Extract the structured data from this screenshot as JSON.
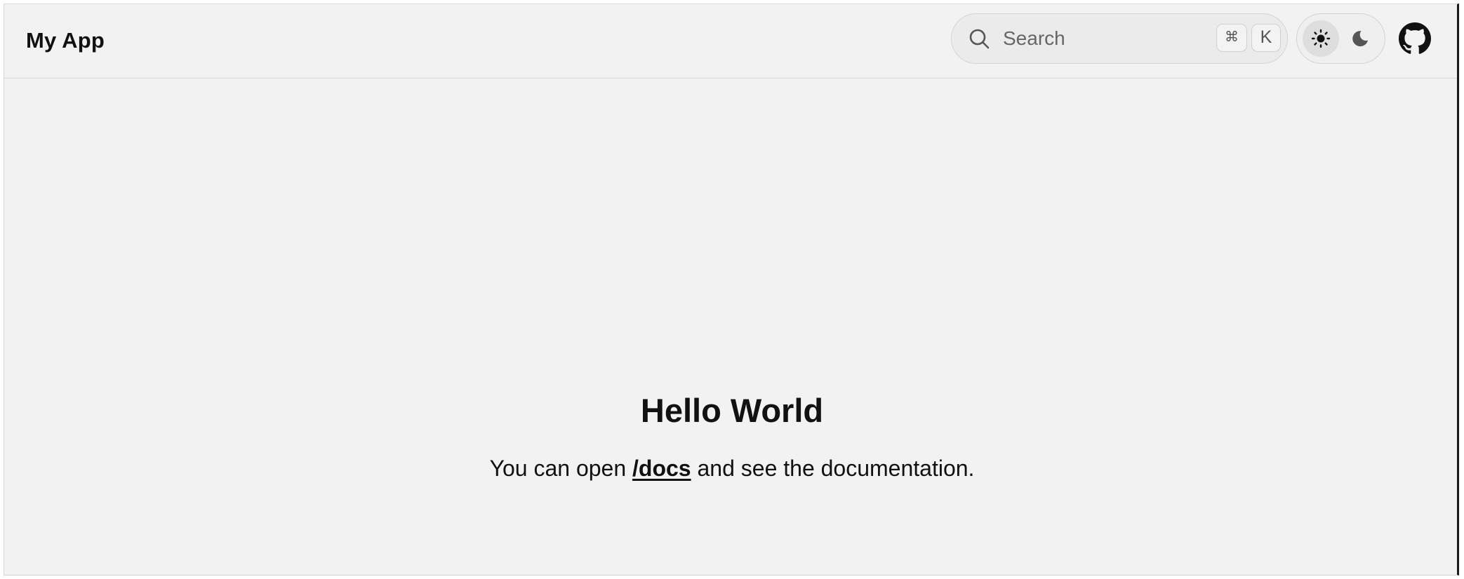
{
  "header": {
    "app_title": "My App",
    "search": {
      "placeholder": "Search",
      "shortcut_modifier": "⌘",
      "shortcut_key": "K"
    },
    "theme_toggle": {
      "light_icon": "sun-icon",
      "dark_icon": "moon-icon",
      "selected": "light"
    },
    "github_icon": "github-icon"
  },
  "main": {
    "heading": "Hello World",
    "text_before": "You can open ",
    "link_text": "/docs",
    "text_after": " and see the documentation."
  },
  "colors": {
    "background": "#f2f2f2",
    "text": "#111111",
    "border": "#d8d8d8",
    "muted_text": "#666666"
  }
}
